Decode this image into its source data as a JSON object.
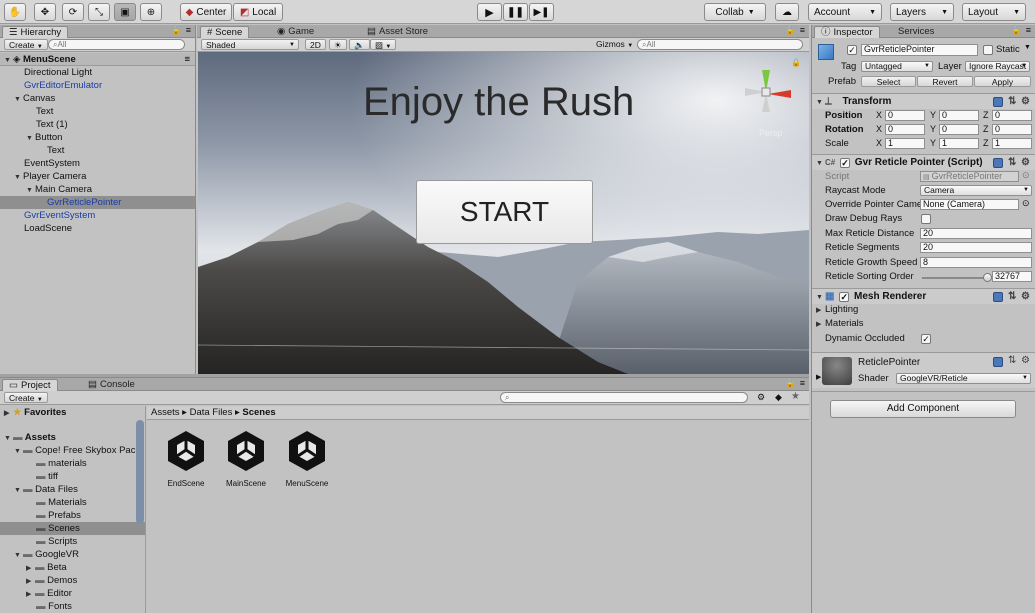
{
  "toolbar": {
    "tools": [
      "hand-tool",
      "move-tool",
      "rotate-tool",
      "scale-tool",
      "rect-tool",
      "transform-tool"
    ],
    "pivot_center": "Center",
    "pivot_local": "Local",
    "collab": "Collab",
    "account": "Account",
    "layers": "Layers",
    "layout": "Layout"
  },
  "hierarchy": {
    "tab": "Hierarchy",
    "create": "Create",
    "search_placeholder": "All",
    "scene_name": "MenuScene",
    "items": [
      {
        "label": "Directional Light"
      },
      {
        "label": "GvrEditorEmulator"
      },
      {
        "label": "Canvas"
      },
      {
        "label": "Text"
      },
      {
        "label": "Text (1)"
      },
      {
        "label": "Button"
      },
      {
        "label": "Text"
      },
      {
        "label": "EventSystem"
      },
      {
        "label": "Player Camera"
      },
      {
        "label": "Main Camera"
      },
      {
        "label": "GvrReticlePointer"
      },
      {
        "label": "GvrEventSystem"
      },
      {
        "label": "LoadScene"
      }
    ]
  },
  "scene_view": {
    "tabs": [
      "Scene",
      "Game",
      "Asset Store"
    ],
    "shading": "Shaded",
    "mode_2d": "2D",
    "gizmos": "Gizmos",
    "search_placeholder": "All",
    "title_text": "Enjoy the Rush",
    "start_button": "START",
    "persp_label": "Persp"
  },
  "project": {
    "tabs": [
      "Project",
      "Console"
    ],
    "create": "Create",
    "favorites": "Favorites",
    "assets": "Assets",
    "tree": [
      {
        "label": "Cope! Free Skybox Pack"
      },
      {
        "label": "materials"
      },
      {
        "label": "tiff"
      },
      {
        "label": "Data Files"
      },
      {
        "label": "Materials"
      },
      {
        "label": "Prefabs"
      },
      {
        "label": "Scenes"
      },
      {
        "label": "Scripts"
      },
      {
        "label": "GoogleVR"
      },
      {
        "label": "Beta"
      },
      {
        "label": "Demos"
      },
      {
        "label": "Editor"
      },
      {
        "label": "Fonts"
      }
    ],
    "breadcrumb": [
      "Assets",
      "Data Files",
      "Scenes"
    ],
    "files": [
      "EndScene",
      "MainScene",
      "MenuScene"
    ]
  },
  "inspector": {
    "tabs": [
      "Inspector",
      "Services"
    ],
    "object_name": "GvrReticlePointer",
    "static_label": "Static",
    "tag_label": "Tag",
    "tag_value": "Untagged",
    "layer_label": "Layer",
    "layer_value": "Ignore Raycast",
    "prefab_label": "Prefab",
    "prefab_select": "Select",
    "prefab_revert": "Revert",
    "prefab_apply": "Apply",
    "transform": {
      "title": "Transform",
      "position_label": "Position",
      "rotation_label": "Rotation",
      "scale_label": "Scale",
      "axes": [
        "X",
        "Y",
        "Z"
      ],
      "position": [
        "0",
        "0",
        "0"
      ],
      "rotation": [
        "0",
        "0",
        "0"
      ],
      "scale": [
        "1",
        "1",
        "1"
      ]
    },
    "reticle": {
      "title": "Gvr Reticle Pointer (Script)",
      "script_label": "Script",
      "script_value": "GvrReticlePointer",
      "raycast_label": "Raycast Mode",
      "raycast_value": "Camera",
      "override_label": "Override Pointer Came",
      "override_value": "None (Camera)",
      "debug_label": "Draw Debug Rays",
      "max_label": "Max Reticle Distance",
      "max_value": "20",
      "segments_label": "Reticle Segments",
      "segments_value": "20",
      "growth_label": "Reticle Growth Speed",
      "growth_value": "8",
      "sorting_label": "Reticle Sorting Order",
      "sorting_value": "32767",
      "sorting_fraction": 1.0
    },
    "mesh": {
      "title": "Mesh Renderer",
      "lighting": "Lighting",
      "materials": "Materials",
      "dynamic_label": "Dynamic Occluded"
    },
    "material": {
      "name": "ReticlePointer",
      "shader_label": "Shader",
      "shader_value": "GoogleVR/Reticle"
    },
    "add_component": "Add Component"
  }
}
